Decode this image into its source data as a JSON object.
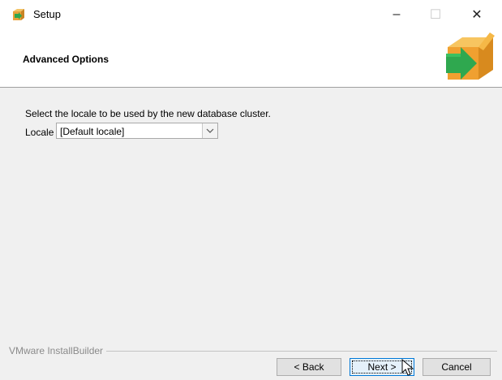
{
  "window": {
    "title": "Setup",
    "app_icon": "box-arrow-icon",
    "minimize_glyph": "–",
    "maximize_glyph": "☐",
    "close_glyph": "✕"
  },
  "header": {
    "title": "Advanced Options",
    "logo": "green-arrow-box-icon"
  },
  "content": {
    "description": "Select the locale to be used by the new database cluster.",
    "locale_label": "Locale",
    "locale_value": "[Default locale]"
  },
  "footer": {
    "brand": "VMware InstallBuilder",
    "back_label": "< Back",
    "next_label": "Next >",
    "cancel_label": "Cancel"
  },
  "colors": {
    "accent": "#0078d7",
    "box_orange": "#f0a030",
    "arrow_green": "#2fa84f"
  }
}
